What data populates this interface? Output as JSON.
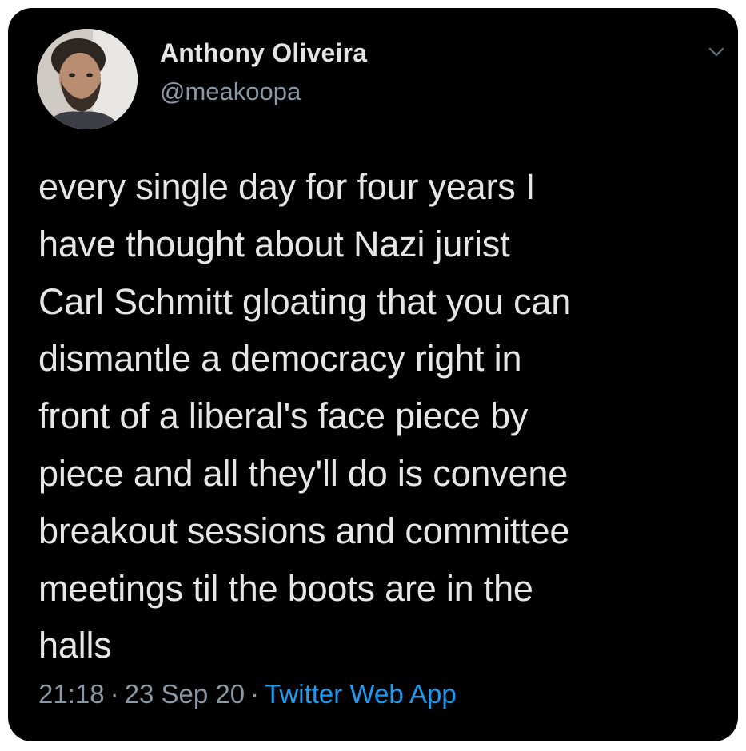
{
  "tweet": {
    "author": {
      "display_name": "Anthony Oliveira",
      "handle": "@meakoopa",
      "avatar_icon": "profile-photo"
    },
    "text": "every single day for four years I\nhave thought about Nazi jurist\nCarl Schmitt gloating that you can\ndismantle a democracy right in\nfront of a liberal's face piece by\npiece and all they'll do is convene\nbreakout sessions and committee\nmeetings til the boots are in the\nhalls",
    "time": "21:18",
    "date": "23 Sep 20",
    "separator": "·",
    "source": "Twitter Web App",
    "menu_icon": "chevron-down-icon"
  },
  "colors": {
    "background": "#000000",
    "text": "#e6e6e6",
    "muted": "#8b98a5",
    "link": "#1d9bf0"
  }
}
